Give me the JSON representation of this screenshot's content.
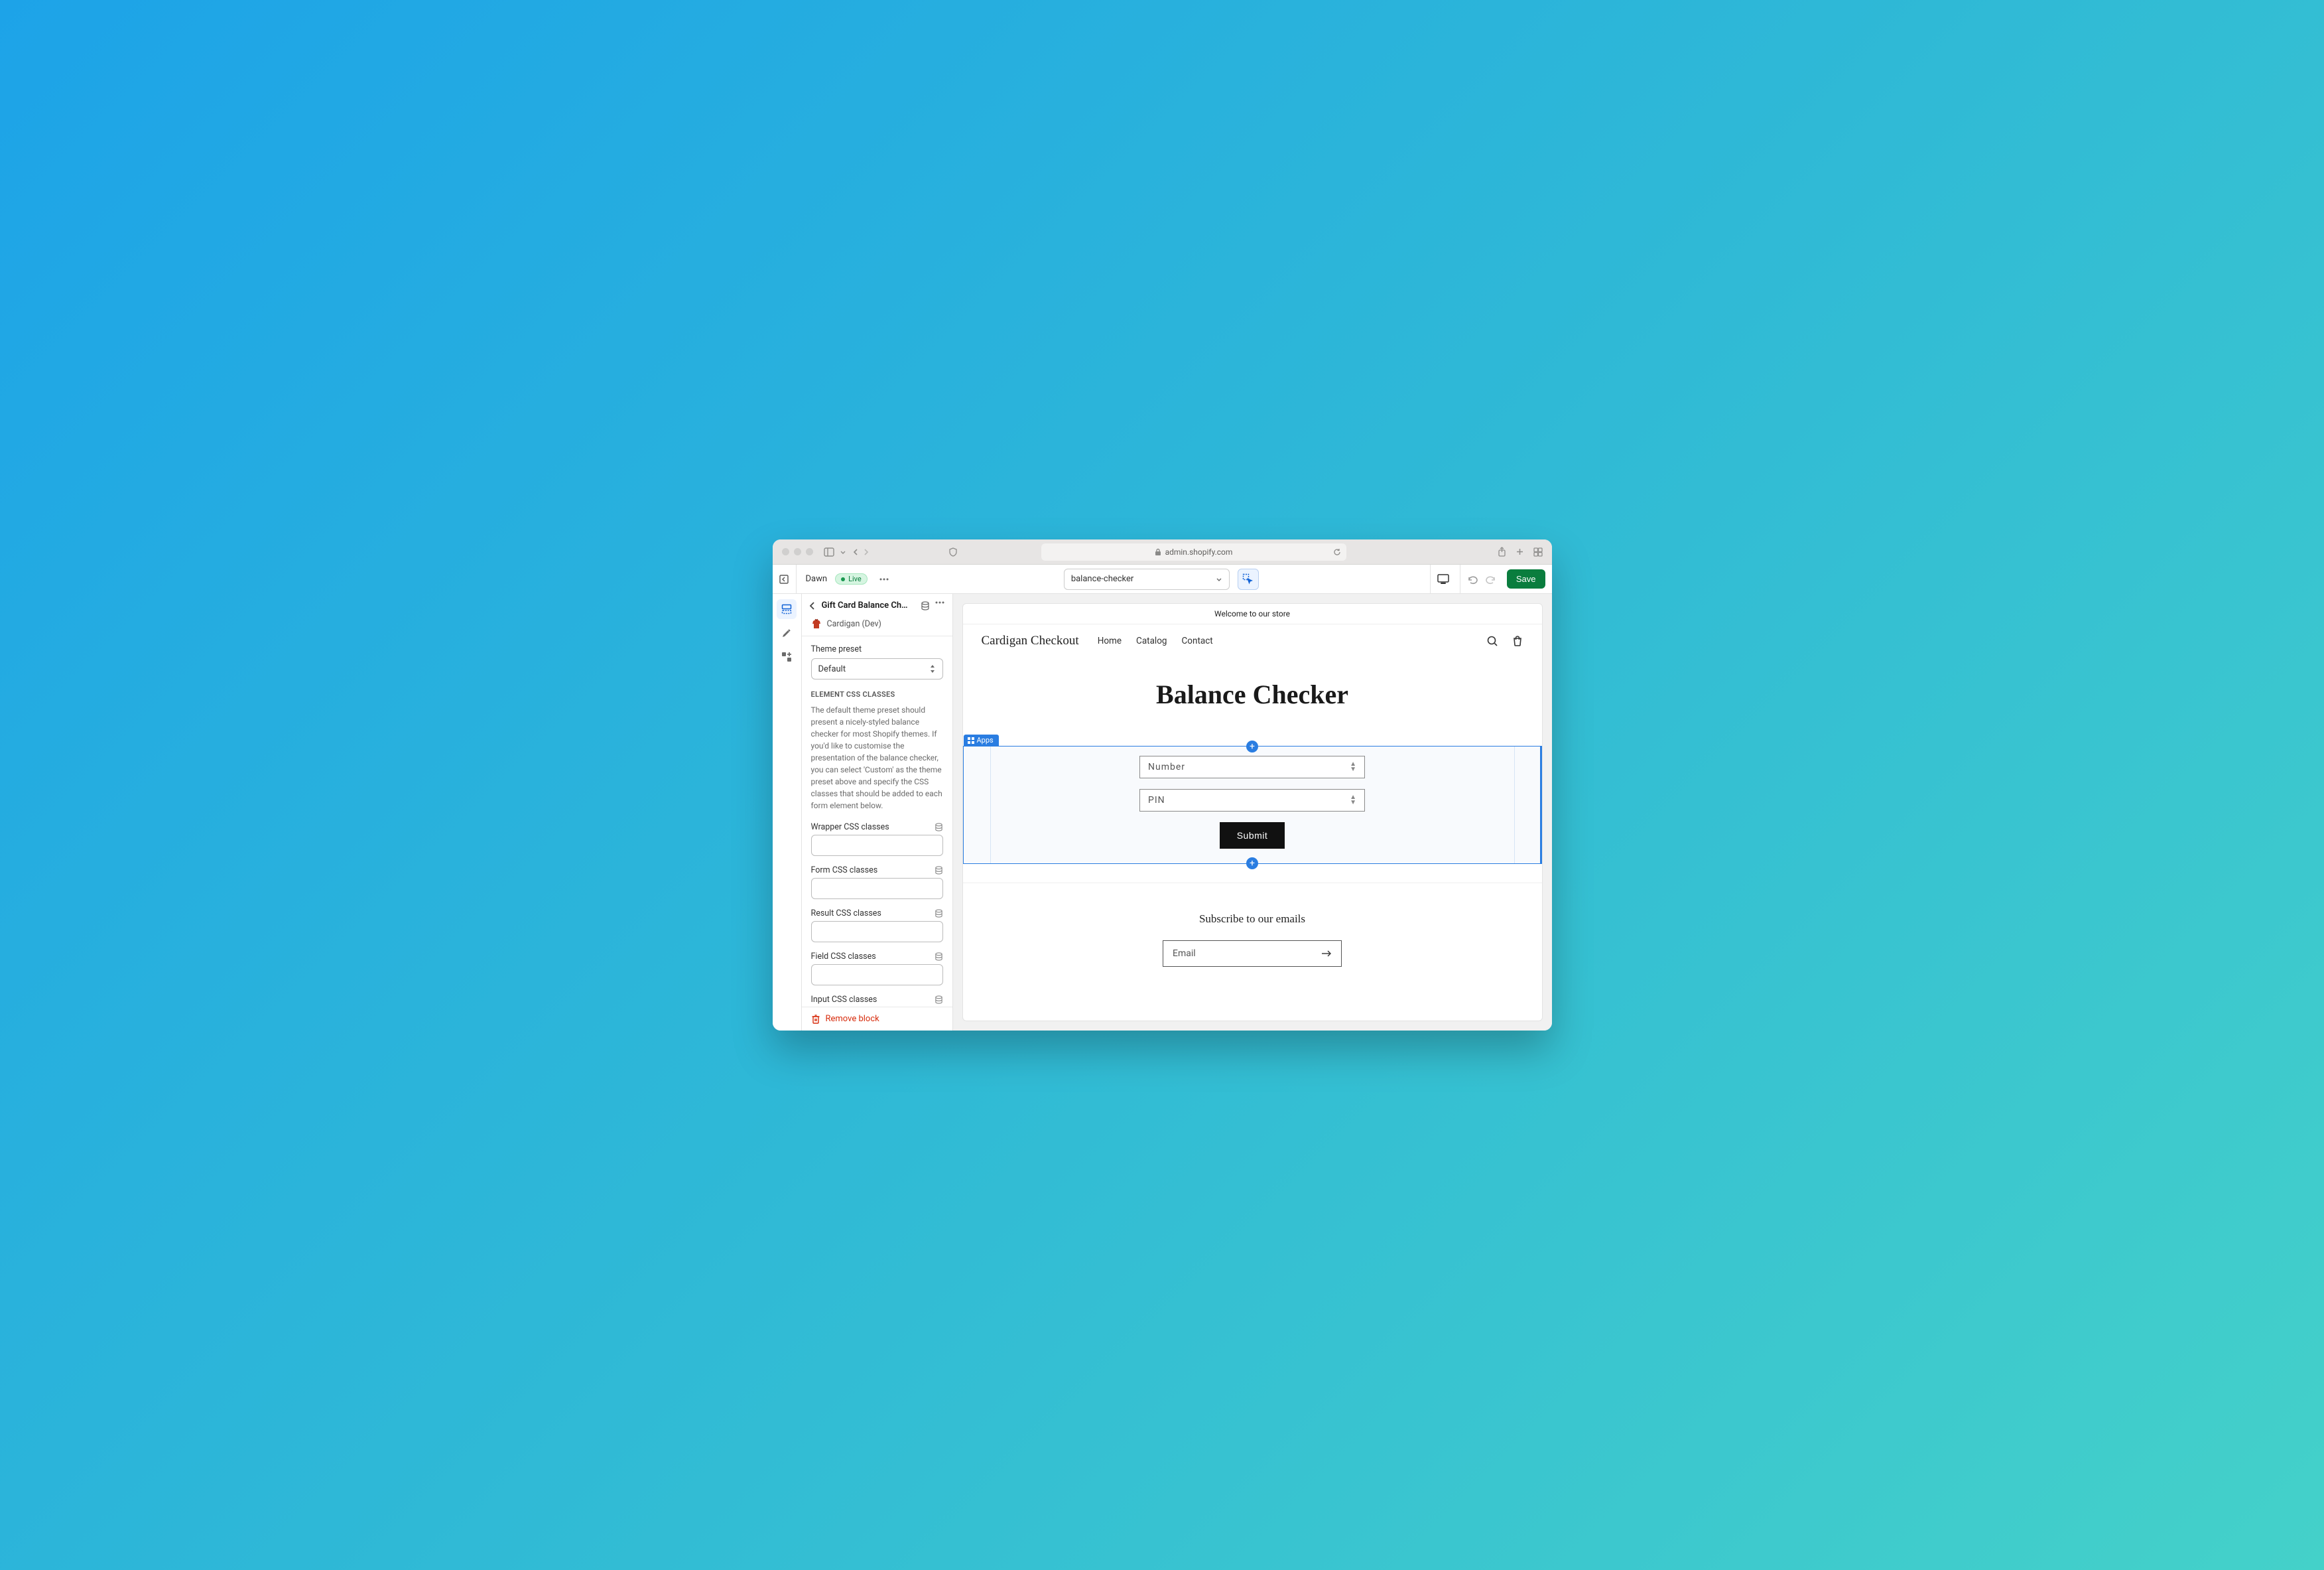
{
  "browser": {
    "url": "admin.shopify.com"
  },
  "topbar": {
    "theme_name": "Dawn",
    "live_badge": "Live",
    "page_select": "balance-checker",
    "save_label": "Save"
  },
  "sidebar": {
    "title": "Gift Card Balance Ch…",
    "app_name": "Cardigan (Dev)",
    "theme_preset_label": "Theme preset",
    "theme_preset_value": "Default",
    "section_title": "ELEMENT CSS CLASSES",
    "help_text": "The default theme preset should present a nicely-styled balance checker for most Shopify themes. If you'd like to customise the presentation of the balance checker, you can select 'Custom' as the theme preset above and specify the CSS classes that should be added to each form element below.",
    "css_fields": [
      {
        "label": "Wrapper CSS classes"
      },
      {
        "label": "Form CSS classes"
      },
      {
        "label": "Result CSS classes"
      },
      {
        "label": "Field CSS classes"
      },
      {
        "label": "Input CSS classes"
      }
    ],
    "remove_label": "Remove block"
  },
  "preview": {
    "announcement": "Welcome to our store",
    "store_name": "Cardigan Checkout",
    "nav": [
      "Home",
      "Catalog",
      "Contact"
    ],
    "page_heading": "Balance Checker",
    "apps_tag": "Apps",
    "form": {
      "number_placeholder": "Number",
      "pin_placeholder": "PIN",
      "submit_label": "Submit"
    },
    "subscribe": {
      "heading": "Subscribe to our emails",
      "email_placeholder": "Email"
    }
  }
}
